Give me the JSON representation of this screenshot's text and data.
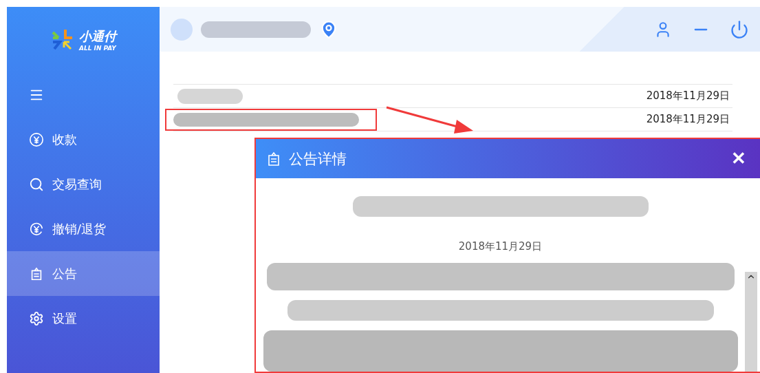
{
  "logo": {
    "name": "小通付",
    "tagline": "ALL IN PAY"
  },
  "nav": [
    {
      "kind": "menu",
      "selected": false
    },
    {
      "kind": "pay",
      "label": "收款",
      "selected": false
    },
    {
      "kind": "search",
      "label": "交易查询",
      "selected": false
    },
    {
      "kind": "refund",
      "label": "撤销/退货",
      "selected": false
    },
    {
      "kind": "notice",
      "label": "公告",
      "selected": true
    },
    {
      "kind": "settings",
      "label": "设置",
      "selected": false
    }
  ],
  "notices": [
    {
      "date": "2018年11月29日",
      "highlighted": false
    },
    {
      "date": "2018年11月29日",
      "highlighted": true
    }
  ],
  "dialog": {
    "title": "公告详情",
    "close": "✕",
    "date": "2018年11月29日"
  }
}
